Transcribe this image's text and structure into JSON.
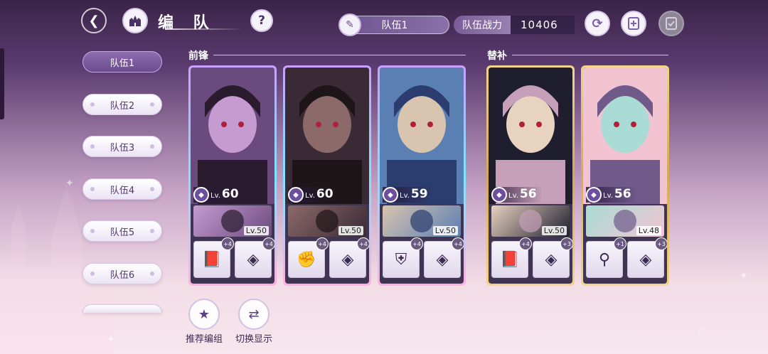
{
  "header": {
    "title": "编 队",
    "team_name": "队伍1",
    "power_label": "队伍战力",
    "power_value": "10406"
  },
  "teams": [
    {
      "label": "队伍1",
      "active": true
    },
    {
      "label": "队伍2",
      "active": false
    },
    {
      "label": "队伍3",
      "active": false
    },
    {
      "label": "队伍4",
      "active": false
    },
    {
      "label": "队伍5",
      "active": false
    },
    {
      "label": "队伍6",
      "active": false
    }
  ],
  "sections": {
    "front": "前锋",
    "sub": "替补"
  },
  "cards": [
    {
      "level_prefix": "Lv.",
      "level": "60",
      "partner_level": "Lv.50",
      "gear1_plus": "+4",
      "gear2_plus": "+4",
      "gear1_icon": "book-icon",
      "gear2_icon": "earring-icon",
      "palette": [
        "#6b4a7e",
        "#c59bd0",
        "#2a1c2e"
      ]
    },
    {
      "level_prefix": "Lv.",
      "level": "60",
      "partner_level": "Lv.50",
      "gear1_plus": "+4",
      "gear2_plus": "+4",
      "gear1_icon": "gauntlet-icon",
      "gear2_icon": "earring-icon",
      "palette": [
        "#3a2a35",
        "#8c6a6a",
        "#1e1518"
      ]
    },
    {
      "level_prefix": "Lv.",
      "level": "59",
      "partner_level": "Lv.50",
      "gear1_plus": "+4",
      "gear2_plus": "+4",
      "gear1_icon": "shield-icon",
      "gear2_icon": "earring-icon",
      "palette": [
        "#5a7fb3",
        "#d9c4b0",
        "#2b3d6e"
      ]
    },
    {
      "level_prefix": "Lv.",
      "level": "56",
      "partner_level": "Lv.50",
      "gear1_plus": "+4",
      "gear2_plus": "+3",
      "gear1_icon": "book-icon",
      "gear2_icon": "earring-icon",
      "palette": [
        "#1e1e2e",
        "#e8d2c0",
        "#c6a0b8"
      ]
    },
    {
      "level_prefix": "Lv.",
      "level": "56",
      "partner_level": "Lv.48",
      "gear1_plus": "+1",
      "gear2_plus": "+3",
      "gear1_icon": "wand-icon",
      "gear2_icon": "earring-icon",
      "palette": [
        "#f2c4d2",
        "#a8dcd4",
        "#6f5a8a"
      ]
    }
  ],
  "bottom": {
    "recommend_label": "推荐编组",
    "switch_label": "切换显示"
  }
}
